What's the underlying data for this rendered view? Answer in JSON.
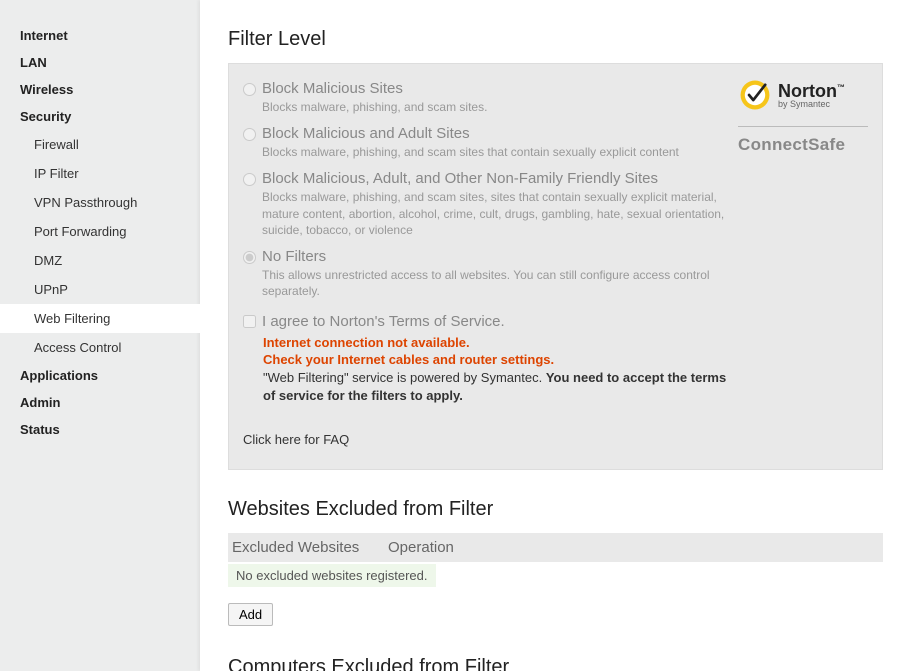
{
  "sidebar": {
    "items": [
      {
        "label": "Internet",
        "sub": []
      },
      {
        "label": "LAN",
        "sub": []
      },
      {
        "label": "Wireless",
        "sub": []
      },
      {
        "label": "Security",
        "sub": [
          {
            "label": "Firewall"
          },
          {
            "label": "IP Filter"
          },
          {
            "label": "VPN Passthrough"
          },
          {
            "label": "Port Forwarding"
          },
          {
            "label": "DMZ"
          },
          {
            "label": "UPnP"
          },
          {
            "label": "Web Filtering",
            "active": true
          },
          {
            "label": "Access Control"
          }
        ]
      },
      {
        "label": "Applications",
        "sub": []
      },
      {
        "label": "Admin",
        "sub": []
      },
      {
        "label": "Status",
        "sub": []
      }
    ]
  },
  "filter": {
    "heading": "Filter Level",
    "options": [
      {
        "title": "Block Malicious Sites",
        "desc": "Blocks malware, phishing, and scam sites.",
        "selected": false
      },
      {
        "title": "Block Malicious and Adult Sites",
        "desc": "Blocks malware, phishing, and scam sites that contain sexually explicit content",
        "selected": false
      },
      {
        "title": "Block Malicious, Adult, and Other Non-Family Friendly Sites",
        "desc": "Blocks malware, phishing, and scam sites, sites that contain sexually explicit material, mature content, abortion, alcohol, crime, cult, drugs, gambling, hate, sexual orientation, suicide, tobacco, or violence",
        "selected": false
      },
      {
        "title": "No Filters",
        "desc": "This allows unrestricted access to all websites. You can still configure access control separately.",
        "selected": true
      }
    ],
    "agree_label": "I agree to Norton's Terms of Service.",
    "err1": "Internet connection not available.",
    "err2": "Check your Internet cables and router settings.",
    "powered_prefix": "\"Web Filtering\" service is powered by Symantec. ",
    "powered_bold": "You need to accept the terms of service for the filters to apply.",
    "faq": "Click here for FAQ",
    "disabled": true
  },
  "norton": {
    "name": "Norton",
    "by": "by Symantec",
    "connectsafe": "ConnectSafe"
  },
  "excluded_sites": {
    "heading": "Websites Excluded from Filter",
    "col1": "Excluded Websites",
    "col2": "Operation",
    "empty": "No excluded websites registered.",
    "add": "Add"
  },
  "excluded_computers": {
    "heading": "Computers Excluded from Filter"
  }
}
